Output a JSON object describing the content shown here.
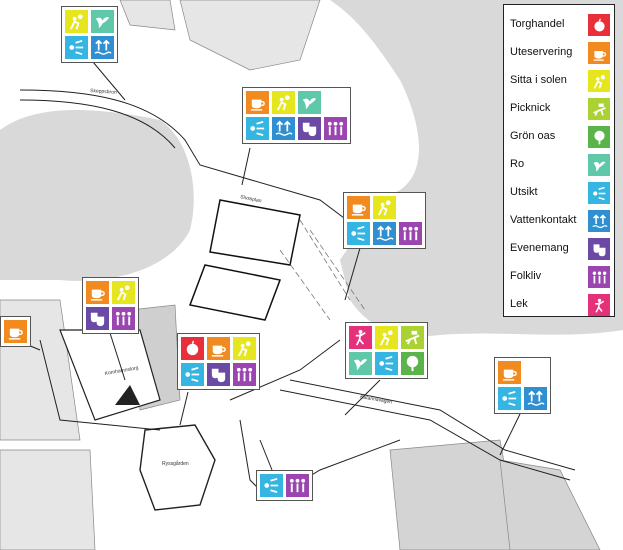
{
  "legend": {
    "items": [
      {
        "key": "torghandel",
        "label": "Torghandel",
        "color": "#e8303a",
        "icon": "apple-icon"
      },
      {
        "key": "uteservering",
        "label": "Uteservering",
        "color": "#f18a1f",
        "icon": "coffee-cup-icon"
      },
      {
        "key": "sitta",
        "label": "Sitta i solen",
        "color": "#e6e61e",
        "icon": "sun-person-icon"
      },
      {
        "key": "picknick",
        "label": "Picknick",
        "color": "#a9d232",
        "icon": "picnic-icon"
      },
      {
        "key": "gron",
        "label": "Grön oas",
        "color": "#5ab44a",
        "icon": "tree-icon"
      },
      {
        "key": "ro",
        "label": "Ro",
        "color": "#5ec8a8",
        "icon": "bird-icon"
      },
      {
        "key": "utsikt",
        "label": "Utsikt",
        "color": "#35b5e2",
        "icon": "view-icon"
      },
      {
        "key": "vatten",
        "label": "Vattenkontakt",
        "color": "#2f8fd0",
        "icon": "water-icon"
      },
      {
        "key": "evenemang",
        "label": "Evenemang",
        "color": "#6b4aa6",
        "icon": "masks-icon"
      },
      {
        "key": "folkliv",
        "label": "Folkliv",
        "color": "#9b45b0",
        "icon": "people-icon"
      },
      {
        "key": "lek",
        "label": "Lek",
        "color": "#e4317a",
        "icon": "play-icon"
      }
    ]
  },
  "map_labels": {
    "street_1": "Slussplan",
    "street_2": "Skeppsbron",
    "street_3": "Katarinavägen",
    "street_4": "Kornhamnstorg",
    "plaza": "Ryssgården"
  },
  "poi_groups": [
    {
      "id": "poi-north",
      "cols": 2,
      "tiles": [
        "sitta",
        "ro",
        "utsikt",
        "vatten"
      ]
    },
    {
      "id": "poi-slussplan",
      "cols": 4,
      "tiles": [
        "uteservering",
        "sitta",
        "ro",
        "blank",
        "utsikt",
        "vatten",
        "evenemang",
        "folkliv"
      ]
    },
    {
      "id": "poi-center-east",
      "cols": 3,
      "tiles": [
        "uteservering",
        "sitta",
        "blank",
        "utsikt",
        "vatten",
        "folkliv"
      ]
    },
    {
      "id": "poi-west",
      "cols": 2,
      "tiles": [
        "uteservering",
        "sitta",
        "evenemang",
        "folkliv"
      ]
    },
    {
      "id": "poi-far-west",
      "cols": 1,
      "tiles": [
        "uteservering"
      ]
    },
    {
      "id": "poi-center",
      "cols": 3,
      "tiles": [
        "torghandel",
        "uteservering",
        "sitta",
        "utsikt",
        "evenemang",
        "folkliv"
      ]
    },
    {
      "id": "poi-east",
      "cols": 3,
      "tiles": [
        "lek",
        "sitta",
        "picknick",
        "ro",
        "utsikt",
        "gron"
      ]
    },
    {
      "id": "poi-far-east",
      "cols": 2,
      "tiles": [
        "uteservering",
        "blank",
        "utsikt",
        "vatten"
      ]
    },
    {
      "id": "poi-south",
      "cols": 2,
      "tiles": [
        "utsikt",
        "folkliv"
      ]
    }
  ]
}
